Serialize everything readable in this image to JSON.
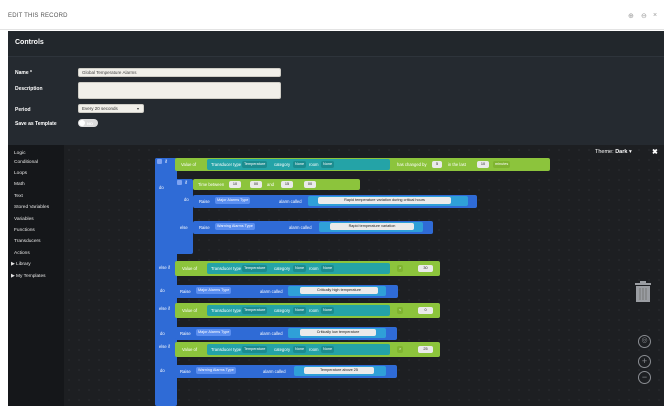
{
  "window": {
    "title": "EDIT THIS RECORD",
    "controls": [
      "⊕",
      "⊖",
      "×"
    ]
  },
  "controls_panel": {
    "heading": "Controls",
    "name_label": "Name *",
    "name_value": "Global Temperature Alarms",
    "description_label": "Description",
    "description_value": "",
    "period_label": "Period",
    "period_value": "Every 20 seconds",
    "save_template_label": "Save as Template",
    "save_template_toggle": "NO"
  },
  "toolbox": {
    "items": [
      "Logic",
      "Conditional",
      "Loops",
      "Math",
      "Text",
      "Stored Variables",
      "Variables",
      "Functions",
      "Transducers",
      "Actions",
      "Library",
      "My Templates"
    ]
  },
  "workspace": {
    "theme_label": "Theme:",
    "theme_value": "Dark",
    "expand_icon": "✖"
  },
  "blocks": {
    "if": "if",
    "do": "do",
    "else_if": "else if",
    "else": "else",
    "value_of": "Value of",
    "transducer_type": "Transducer type",
    "temperature": "Temperature",
    "category": "category",
    "none": "None",
    "room": "room",
    "has_changed_by": "has changed by",
    "changed_by_value": "5",
    "in_the_last": "in the last",
    "last_value": "10",
    "minutes": "minutes",
    "time_between": "Time between",
    "time_h1": "10",
    "time_m1": "00",
    "and": "and",
    "time_h2": "15",
    "time_m2": "00",
    "raise": "Raise",
    "major_alarm": "Major Alarms Type",
    "warning_alarm": "Warning Alarms Type",
    "alarm_called": "alarm called",
    "msg1": "Rapid temperature variation during critical hours",
    "msg2": "Rapid temperature variation",
    "gt": ">",
    "lt": "<",
    "val_30": "30",
    "val_0": "0",
    "val_25": "25",
    "msg_high": "Critically high temperature",
    "msg_low": "Critically low temperature",
    "msg_above": "Temperature above 25"
  },
  "colors": {
    "green": "#8cc43c",
    "blue": "#2f6bd6",
    "teal": "#24a3a7",
    "cyan": "#27b3d1",
    "purple": "#6a4fc4",
    "string": "#2fa0d8"
  }
}
